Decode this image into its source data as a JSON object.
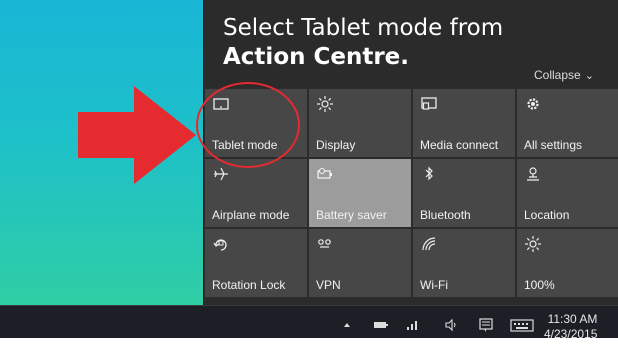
{
  "instruction": {
    "line1": "Select Tablet mode from",
    "line2": "Action Centre."
  },
  "action_centre": {
    "collapse_label": "Collapse",
    "tiles": [
      {
        "label": "Tablet mode",
        "icon": "tablet-mode-icon"
      },
      {
        "label": "Display",
        "icon": "brightness-icon"
      },
      {
        "label": "Media connect",
        "icon": "media-connect-icon"
      },
      {
        "label": "All settings",
        "icon": "gear-icon"
      },
      {
        "label": "Airplane mode",
        "icon": "airplane-icon"
      },
      {
        "label": "Battery saver",
        "icon": "battery-saver-icon",
        "active": true
      },
      {
        "label": "Bluetooth",
        "icon": "bluetooth-icon"
      },
      {
        "label": "Location",
        "icon": "location-icon"
      },
      {
        "label": "Rotation Lock",
        "icon": "rotation-lock-icon"
      },
      {
        "label": "VPN",
        "icon": "vpn-icon"
      },
      {
        "label": "Wi-Fi",
        "icon": "wifi-icon"
      },
      {
        "label": "100%",
        "icon": "brightness-icon"
      }
    ]
  },
  "taskbar": {
    "time": "11:30 AM",
    "date": "4/23/2015"
  },
  "colors": {
    "accent_red": "#e52a30",
    "tile": "#474747",
    "tile_active": "#9c9c9c",
    "panel": "#2b2b2b"
  }
}
